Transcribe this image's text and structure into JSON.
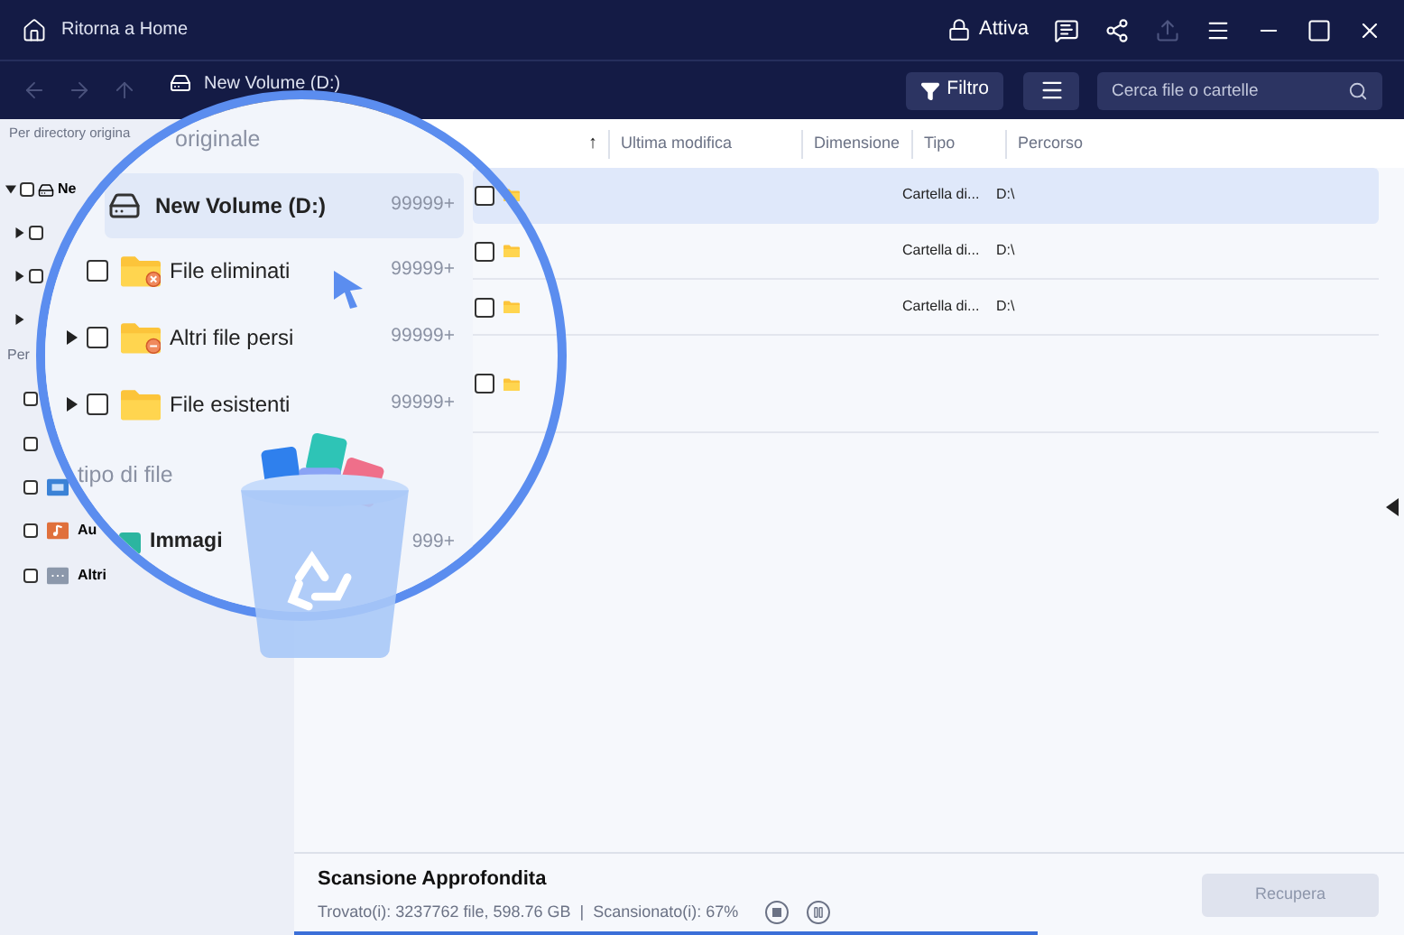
{
  "title_bar": {
    "home_label": "Ritorna a Home",
    "activate_label": "Attiva",
    "icons": [
      {
        "kind": "chat",
        "disabled": false
      },
      {
        "kind": "share",
        "disabled": false
      },
      {
        "kind": "export",
        "disabled": true
      },
      {
        "kind": "menu",
        "disabled": false
      },
      {
        "kind": "minimize",
        "disabled": false
      },
      {
        "kind": "maximize",
        "disabled": false
      },
      {
        "kind": "close",
        "disabled": false
      }
    ]
  },
  "toolbar": {
    "nav": [
      {
        "kind": "back",
        "disabled": true
      },
      {
        "kind": "forward",
        "disabled": true
      },
      {
        "kind": "up",
        "disabled": true
      }
    ],
    "location": "New Volume (D:)",
    "filter_label": "Filtro",
    "search": {
      "placeholder": "Cerca file o cartelle"
    }
  },
  "sidebar": {
    "directory_title": "Per directory origina",
    "tree": [
      {
        "label": "Ne",
        "expanded": true,
        "checked": false
      },
      {
        "expanded": false,
        "checked": false
      },
      {
        "expanded": false,
        "checked": false
      },
      {
        "expanded": false
      }
    ],
    "type_title": "Per",
    "types": [
      {
        "kind": "blank",
        "checked": false
      },
      {
        "kind": "blank",
        "checked": false
      },
      {
        "kind": "document",
        "checked": false
      },
      {
        "kind": "audio",
        "label": "Au",
        "checked": false
      },
      {
        "kind": "other",
        "label": "Altri",
        "checked": false
      }
    ]
  },
  "table": {
    "columns": [
      "↑",
      "Ultima modifica",
      "Dimensione",
      "Tipo",
      "Percorso"
    ],
    "rows": [
      {
        "selected": true,
        "checked": false,
        "type": "Cartella di...",
        "path": "D:\\"
      },
      {
        "selected": false,
        "checked": false,
        "type": "Cartella di...",
        "path": "D:\\"
      },
      {
        "selected": false,
        "checked": false,
        "type": "Cartella di...",
        "path": "D:\\"
      },
      {
        "selected": false,
        "checked": false
      }
    ]
  },
  "magnifier": {
    "section_title": "originale",
    "drive": {
      "label": "New Volume (D:)",
      "count": "99999+",
      "selected": true
    },
    "folders": [
      {
        "kind": "deleted",
        "label": "File eliminati",
        "count": "99999+",
        "checked": false,
        "expandable": false
      },
      {
        "kind": "lost",
        "label": "Altri file persi",
        "count": "99999+",
        "checked": false,
        "expandable": true
      },
      {
        "kind": "plain",
        "label": "File esistenti",
        "count": "99999+",
        "checked": false,
        "expandable": true
      }
    ],
    "type_title": "tipo di file",
    "type_row": {
      "label": "Immagi",
      "count": "999+"
    }
  },
  "status": {
    "title": "Scansione Approfondita",
    "found": "Trovato(i): 3237762 file, 598.76 GB",
    "separator": "|",
    "scanned": "Scansionato(i): 67%",
    "level": 0.67,
    "recover_label": "Recupera",
    "recover_disabled": true
  }
}
